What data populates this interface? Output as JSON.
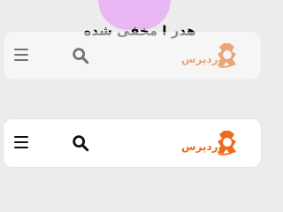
{
  "top_label": "هدر ا مخفی شده",
  "logo": {
    "text": "وردپرس"
  },
  "icons": {
    "menu": "menu-icon",
    "search": "search-icon"
  },
  "colors": {
    "background": "#ececec",
    "card": "#ffffff",
    "accent_pill": "#e8b7f4",
    "logo_orange": "#ef6a1b",
    "icon_dark": "#111111"
  }
}
